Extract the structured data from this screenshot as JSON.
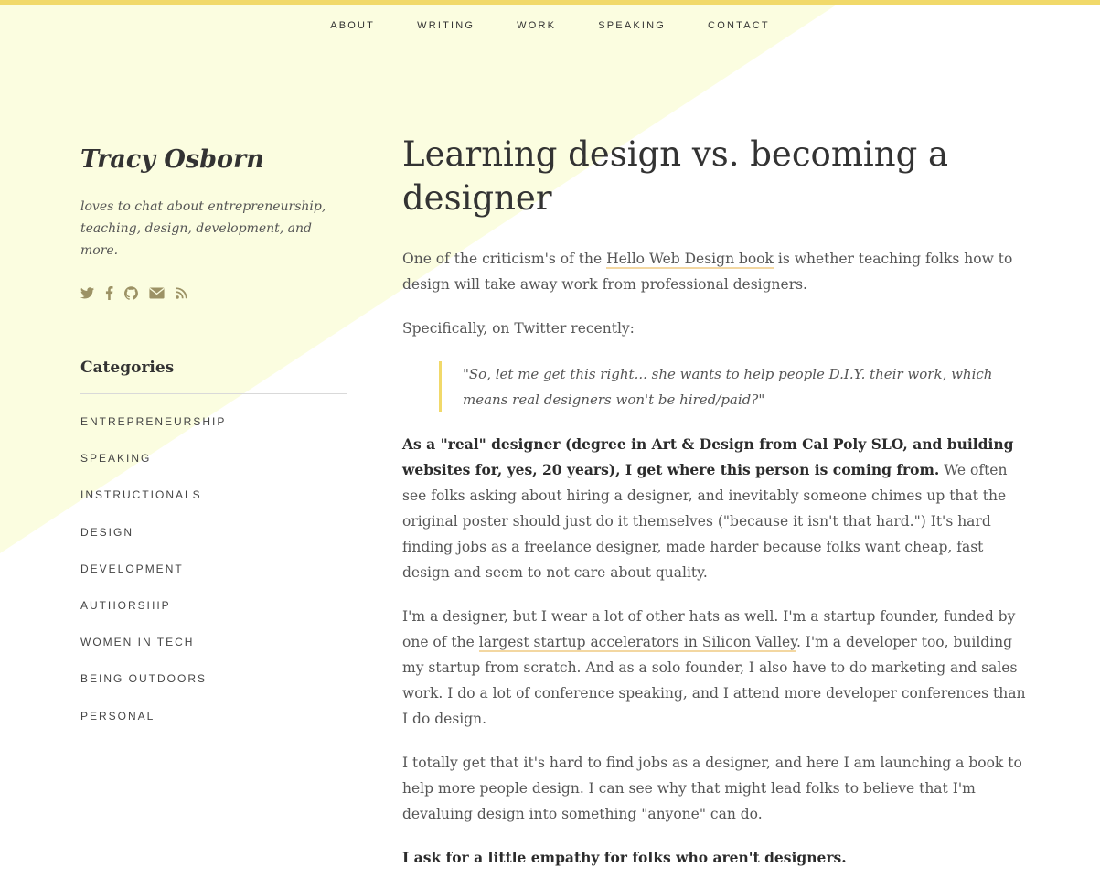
{
  "nav": {
    "items": [
      "ABOUT",
      "WRITING",
      "WORK",
      "SPEAKING",
      "CONTACT"
    ]
  },
  "sidebar": {
    "site_name": "Tracy Osborn",
    "tagline": "loves to chat about entrepreneurship, teaching, design, development, and more.",
    "social_icons": [
      "twitter-icon",
      "facebook-icon",
      "github-icon",
      "email-icon",
      "rss-icon"
    ],
    "categories_heading": "Categories",
    "categories": [
      "ENTREPRENEURSHIP",
      "SPEAKING",
      "INSTRUCTIONALS",
      "DESIGN",
      "DEVELOPMENT",
      "AUTHORSHIP",
      "WOMEN IN TECH",
      "BEING OUTDOORS",
      "PERSONAL"
    ]
  },
  "article": {
    "title": "Learning design vs. becoming a designer",
    "p1_before": "One of the criticism's of the ",
    "p1_link": "Hello Web Design book",
    "p1_after": " is whether teaching folks how to design will take away work from professional designers.",
    "p2": "Specifically, on Twitter recently:",
    "quote": "\"So, let me get this right... she wants to help people D.I.Y. their work, which means real designers won't be hired/paid?\"",
    "p3_bold": "As a \"real\" designer (degree in Art & Design from Cal Poly SLO, and building websites for, yes, 20 years), I get where this person is coming from.",
    "p3_rest": " We often see folks asking about hiring a designer, and inevitably someone chimes up that the original poster should just do it themselves (\"because it isn't that hard.\") It's hard finding jobs as a freelance designer, made harder because folks want cheap, fast design and seem to not care about quality.",
    "p4_before": "I'm a designer, but I wear a lot of other hats as well. I'm a startup founder, funded by one of the ",
    "p4_link": "largest startup accelerators in Silicon Valley",
    "p4_after": ". I'm a developer too, building my startup from scratch. And as a solo founder, I also have to do marketing and sales work. I do a lot of conference speaking, and I attend more developer conferences than I do design.",
    "p5": "I totally get that it's hard to find jobs as a designer, and here I am launching a book to help more people design. I can see why that might lead folks to believe that I'm devaluing design into something \"anyone\" can do.",
    "p6": "I ask for a little empathy for folks who aren't designers."
  },
  "colors": {
    "accent_bar": "#f1d96a",
    "background_wash": "#fbfde0",
    "link_underline": "#f3d7a1",
    "icon": "#9c9265"
  }
}
